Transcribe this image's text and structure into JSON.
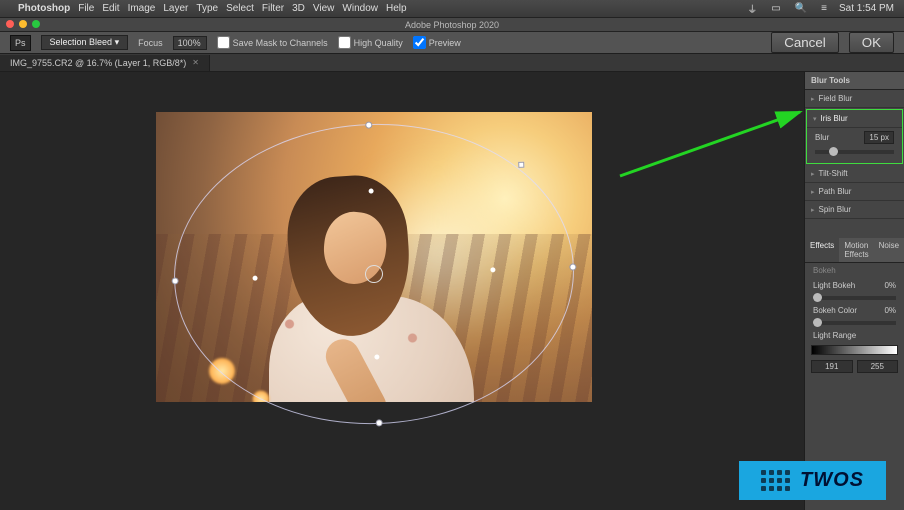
{
  "os": {
    "app_label": "Photoshop",
    "menu": [
      "File",
      "Edit",
      "Image",
      "Layer",
      "Type",
      "Select",
      "Filter",
      "3D",
      "View",
      "Window",
      "Help"
    ],
    "clock": "Sat 1:54 PM"
  },
  "window": {
    "title": "Adobe Photoshop 2020"
  },
  "options_bar": {
    "tool_menu": "Selection Bleed",
    "focus_label": "Focus",
    "focus_value": "100%",
    "save_mask": "Save Mask to Channels",
    "high_quality": "High Quality",
    "preview": "Preview",
    "cancel": "Cancel",
    "ok": "OK"
  },
  "document": {
    "tab_title": "IMG_9755.CR2 @ 16.7% (Layer 1, RGB/8*)"
  },
  "blur_panel": {
    "title": "Blur Tools",
    "sections": {
      "field": "Field Blur",
      "iris": "Iris Blur",
      "blur_label": "Blur",
      "blur_value": "15 px",
      "tilt": "Tilt-Shift",
      "path": "Path Blur",
      "spin": "Spin Blur"
    }
  },
  "effects_panel": {
    "tabs": [
      "Effects",
      "Motion Effects",
      "Noise"
    ],
    "bokeh": "Bokeh",
    "light_bokeh_label": "Light Bokeh",
    "light_bokeh_value": "0%",
    "bokeh_color_label": "Bokeh Color",
    "bokeh_color_value": "0%",
    "light_range_label": "Light Range",
    "range_lo": "191",
    "range_hi": "255"
  },
  "overlay_logo": "TWOS"
}
